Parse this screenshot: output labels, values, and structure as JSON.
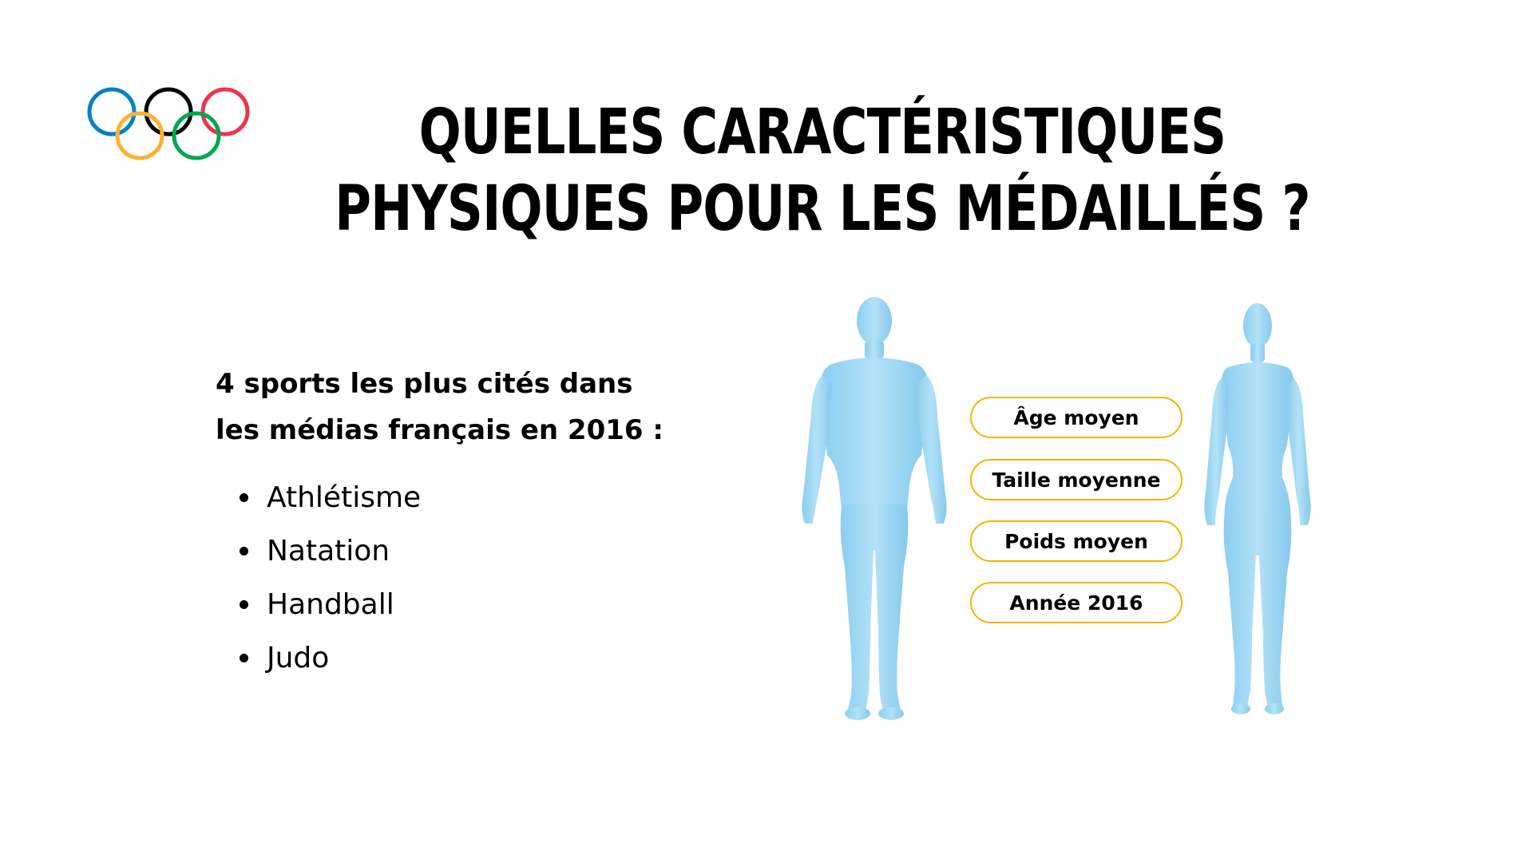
{
  "title": {
    "line1": "Quelles caractéristiques",
    "line2": "physiques pour les médaillés ?"
  },
  "intro": {
    "line1": "4 sports les plus cités dans",
    "line2": "les médias français en 2016 :"
  },
  "sports": [
    "Athlétisme",
    "Natation",
    "Handball",
    "Judo"
  ],
  "pills": [
    "Âge moyen",
    "Taille moyenne",
    "Poids moyen",
    "Année 2016"
  ],
  "colors": {
    "ring_blue": "#0081c8",
    "ring_yellow": "#fcb131",
    "ring_black": "#000000",
    "ring_green": "#00a651",
    "ring_red": "#ee334e",
    "pill_border": "#f5b400",
    "body_fill": "#9fd6f2"
  },
  "icons": {
    "logo": "olympic-rings-icon",
    "male": "male-body-icon",
    "female": "female-body-icon"
  }
}
